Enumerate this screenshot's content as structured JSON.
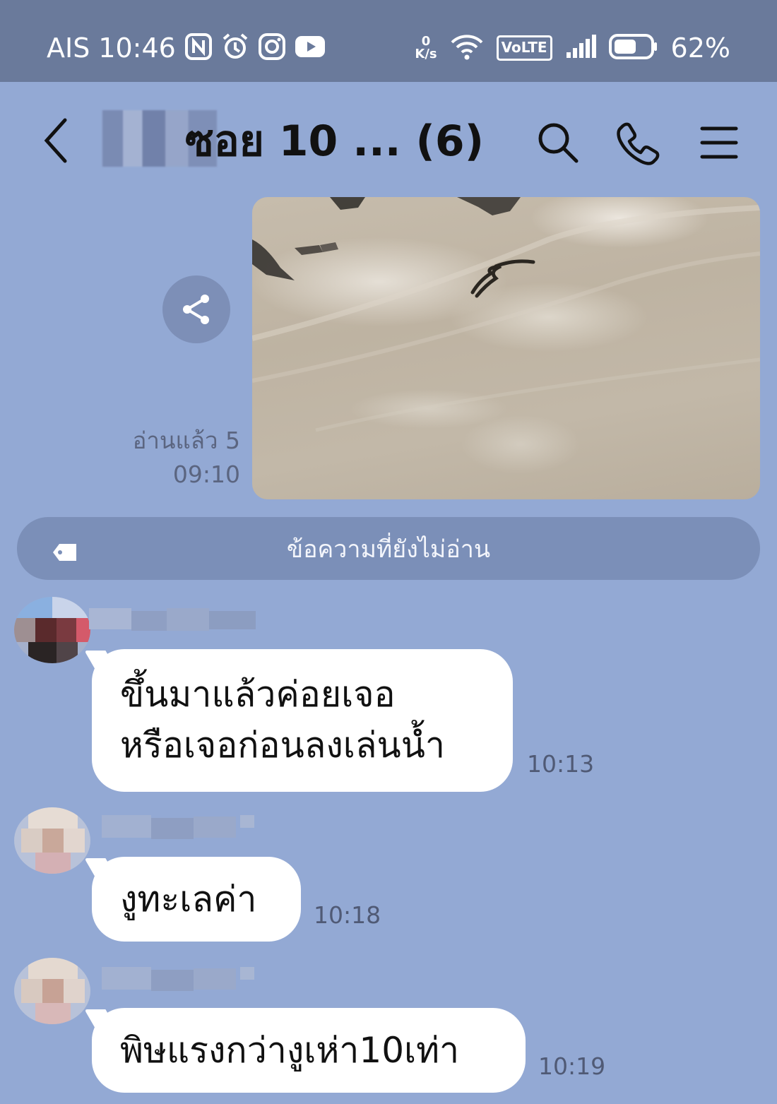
{
  "status_bar": {
    "carrier": "AIS",
    "time": "10:46",
    "net_speed_value": "0",
    "net_speed_unit": "K/s",
    "volte": "VoLTE",
    "battery": "62%",
    "battery_level": 0.62,
    "icons": [
      "nfc-icon",
      "alarm-icon",
      "instagram-icon",
      "youtube-icon",
      "wifi-icon",
      "signal-icon",
      "battery-icon"
    ]
  },
  "header": {
    "title": "ซอย 10 ... (6)",
    "icons": [
      "back-icon",
      "search-icon",
      "phone-icon",
      "menu-icon"
    ]
  },
  "image_message": {
    "read_status": "อ่านแล้ว 5",
    "time": "09:10"
  },
  "unread_divider": {
    "label": "ข้อความที่ยังไม่อ่าน"
  },
  "messages": [
    {
      "lines": [
        "ขึ้นมาแล้วค่อยเจอ",
        "หรือเจอก่อนลงเล่นน้ำ"
      ],
      "time": "10:13"
    },
    {
      "lines": [
        "งูทะเลค่า"
      ],
      "time": "10:18"
    },
    {
      "lines": [
        "พิษแรงกว่างูเห่า10เท่า"
      ],
      "time": "10:19"
    }
  ],
  "colors": {
    "chat_background": "#93a9d4",
    "status_bar": "#6a7a9b",
    "bubble": "#ffffff",
    "unread_divider": "#7b8fb8"
  }
}
